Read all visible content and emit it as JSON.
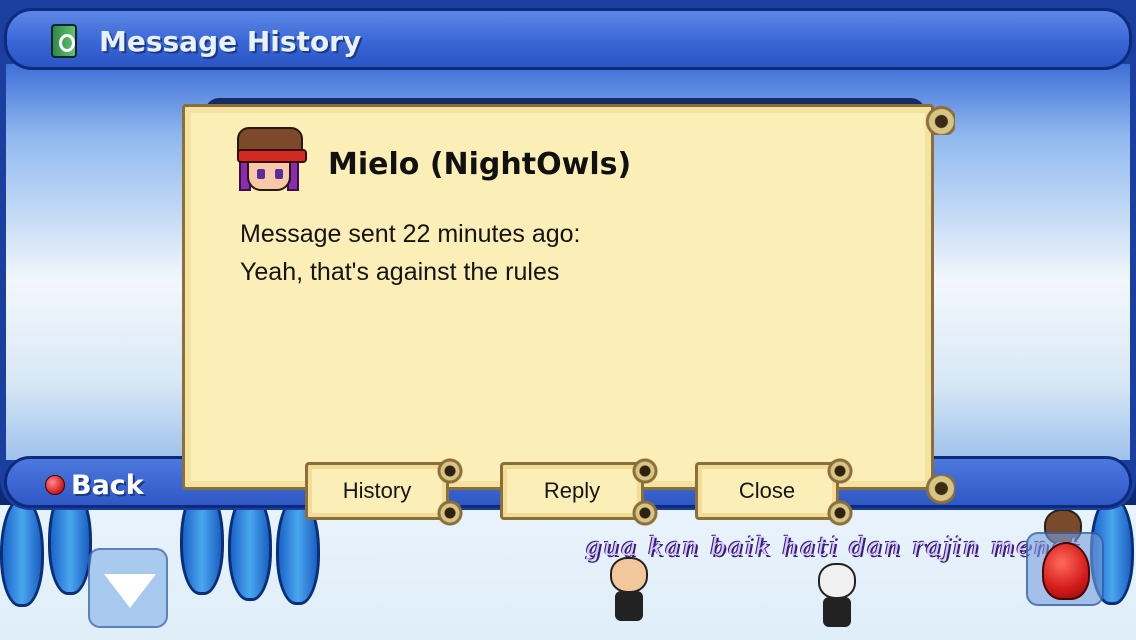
{
  "window": {
    "title": "Message History",
    "back_label": "Back"
  },
  "message": {
    "sender": "Mielo (NightOwls)",
    "meta": "Message sent 22 minutes ago:",
    "text": "Yeah, that's against the rules"
  },
  "actions": {
    "history_label": "History",
    "reply_label": "Reply",
    "close_label": "Close"
  },
  "world": {
    "chat_text": "gua kan baik hati dan rajin menat"
  },
  "colors": {
    "window_blue": "#1a3f9e",
    "scroll_paper": "#fbeeb7",
    "back_dot": "#d21f1f"
  }
}
